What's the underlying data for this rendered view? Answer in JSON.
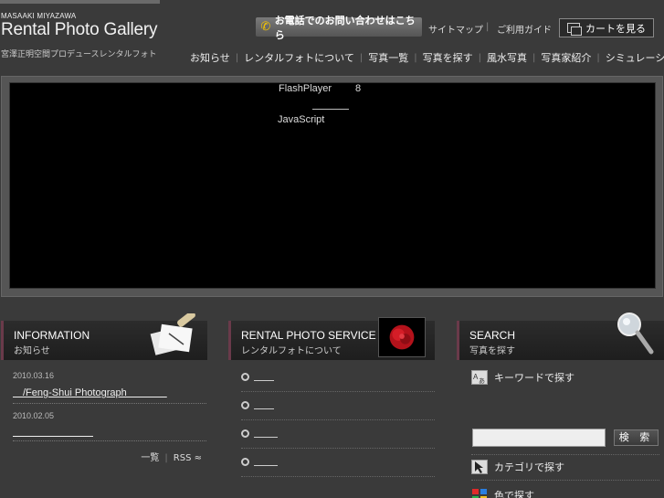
{
  "header": {
    "brand_top": "MASAAKI MIYAZAWA",
    "brand_main": "Rental Photo Gallery",
    "brand_sub": "宮澤正明空間プロデュースレンタルフォト",
    "phone_button": "お電話でのお問い合わせはこちら",
    "sitemap": "サイトマップ",
    "guide": "ご利用ガイド",
    "cart": "カートを見る"
  },
  "nav": {
    "items": [
      "お知らせ",
      "レンタルフォトについて",
      "写真一覧",
      "写真を探す",
      "風水写真",
      "写真家紹介",
      "シミュレーション"
    ]
  },
  "flash": {
    "line1": "FlashPlayer",
    "line1_num": "8",
    "line2": "JavaScript"
  },
  "information": {
    "title": "INFORMATION",
    "subtitle": "お知らせ",
    "items": [
      {
        "date": "2010.03.16",
        "title": "　/Feng-Shui Photograph　　　　"
      },
      {
        "date": "2010.02.05",
        "title": "　　　　　　　　"
      }
    ],
    "list_link": "一覧",
    "rss_link": "RSS"
  },
  "service": {
    "title": "RENTAL PHOTO SERVICE",
    "subtitle": "レンタルフォトについて"
  },
  "search": {
    "title": "SEARCH",
    "subtitle": "写真を探す",
    "keyword_label": "キーワードで探す",
    "keyword_value": "",
    "search_button": "検 索",
    "category_label": "カテゴリで探す",
    "color_label": "色で探す"
  },
  "colors": {
    "background": "#3a3a3a",
    "panel_head": "#1e1e1e",
    "accent_border": "#6a3a4a",
    "phone_icon": "#f5c400"
  }
}
